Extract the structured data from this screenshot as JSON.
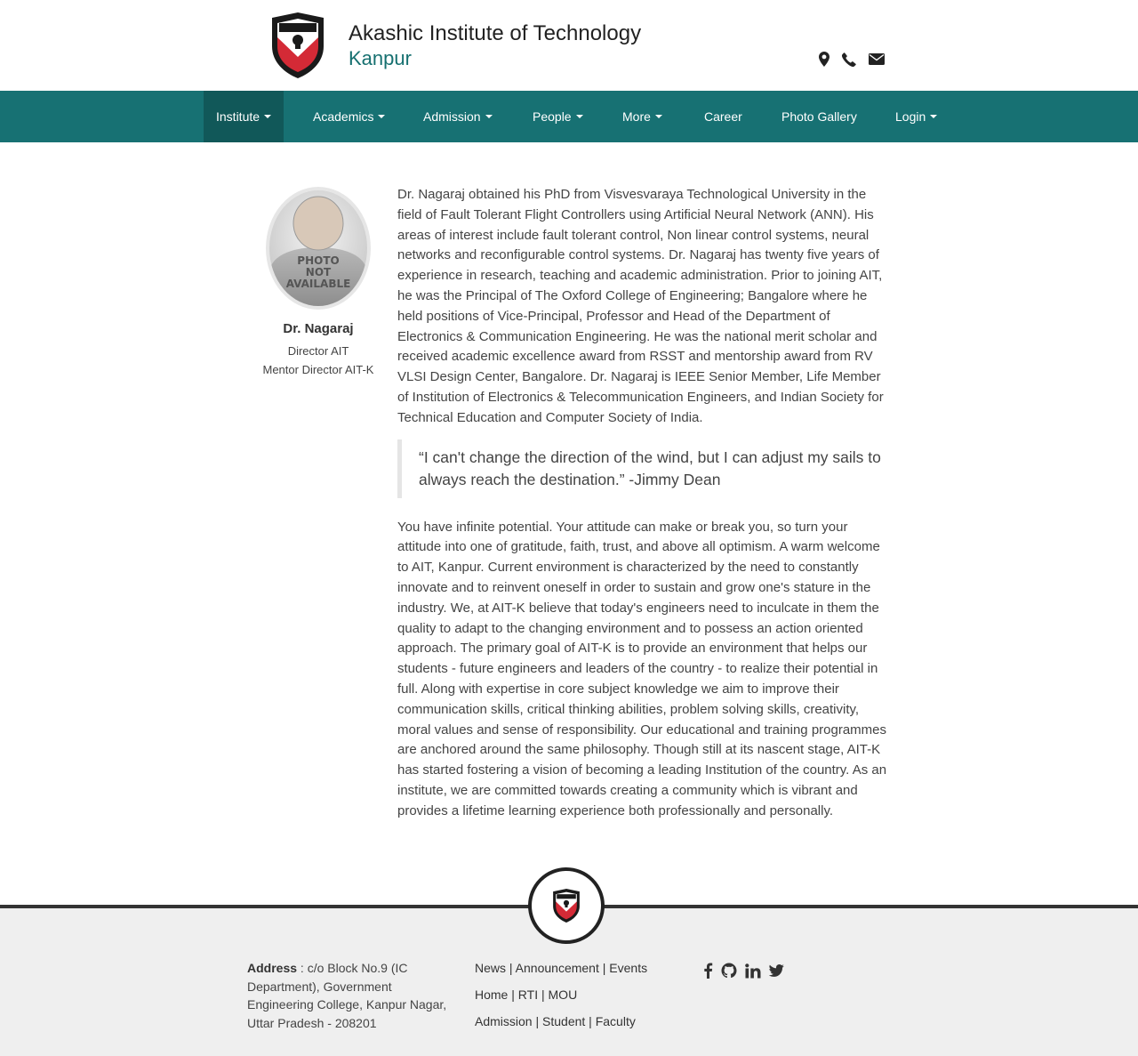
{
  "header": {
    "title": "Akashic Institute of Technology",
    "subtitle": "Kanpur",
    "contact_icons": [
      "map-marker-icon",
      "phone-icon",
      "envelope-icon"
    ]
  },
  "nav": {
    "items": [
      {
        "label": "Institute",
        "dropdown": true,
        "active": true
      },
      {
        "label": "Academics",
        "dropdown": true
      },
      {
        "label": "Admission",
        "dropdown": true
      },
      {
        "label": "People",
        "dropdown": true
      },
      {
        "label": "More",
        "dropdown": true
      },
      {
        "label": "Career",
        "dropdown": false
      },
      {
        "label": "Photo Gallery",
        "dropdown": false
      },
      {
        "label": "Login",
        "dropdown": true
      }
    ]
  },
  "profile": {
    "photo_text": [
      "PHOTO",
      "NOT",
      "AVAILABLE"
    ],
    "name": "Dr. Nagaraj",
    "role1": "Director AIT",
    "role2": "Mentor Director AIT-K"
  },
  "content": {
    "bio": "Dr. Nagaraj obtained his PhD from Visvesvaraya Technological University in the field of Fault Tolerant Flight Controllers using Artificial Neural Network (ANN). His areas of interest include fault tolerant control, Non linear control systems, neural networks and reconfigurable control systems. Dr. Nagaraj has twenty five years of experience in research, teaching and academic administration. Prior to joining AIT, he was the Principal of The Oxford College of Engineering; Bangalore where he held positions of Vice-Principal, Professor and Head of the Department of Electronics & Communication Engineering. He was the national merit scholar and received academic excellence award from RSST and mentorship award from RV VLSI Design Center, Bangalore. Dr. Nagaraj is IEEE Senior Member, Life Member of Institution of Electronics & Telecommunication Engineers, and Indian Society for Technical Education and Computer Society of India.",
    "quote": "“I can't change the direction of the wind, but I can adjust my sails to always reach the destination.” -Jimmy Dean",
    "message": "You have infinite potential. Your attitude can make or break you, so turn your attitude into one of gratitude, faith, trust, and above all optimism. A warm welcome to AIT, Kanpur. Current environment is characterized by the need to constantly innovate and to reinvent oneself in order to sustain and grow one's stature in the industry. We, at AIT-K believe that today's engineers need to inculcate in them the quality to adapt to the changing environment and to possess an action oriented approach. The primary goal of AIT-K is to provide an environment that helps our students - future engineers and leaders of the country - to realize their potential in full. Along with expertise in core subject knowledge we aim to improve their communication skills, critical thinking abilities, problem solving skills, creativity, moral values and sense of responsibility. Our educational and training programmes are anchored around the same philosophy. Though still at its nascent stage, AIT-K has started fostering a vision of becoming a leading Institution of the country. As an institute, we are committed towards creating a community which is vibrant and provides a lifetime learning experience both professionally and personally."
  },
  "footer": {
    "address_label": "Address",
    "address_text": " : c/o Block No.9 (IC Department), Government Engineering College, Kanpur Nagar, Uttar Pradesh - 208201",
    "link_rows": [
      [
        "News",
        "Announcement",
        "Events"
      ],
      [
        "Home",
        "RTI",
        "MOU"
      ],
      [
        "Admission",
        "Student",
        "Faculty"
      ]
    ],
    "separator": "|",
    "social_icons": [
      "facebook-icon",
      "github-icon",
      "linkedin-icon",
      "twitter-icon"
    ]
  },
  "colors": {
    "nav_bg": "#177173",
    "nav_active": "#115859",
    "brand_sub": "#167070",
    "shield_red": "#d42a36",
    "footer_bg": "#efefef"
  }
}
